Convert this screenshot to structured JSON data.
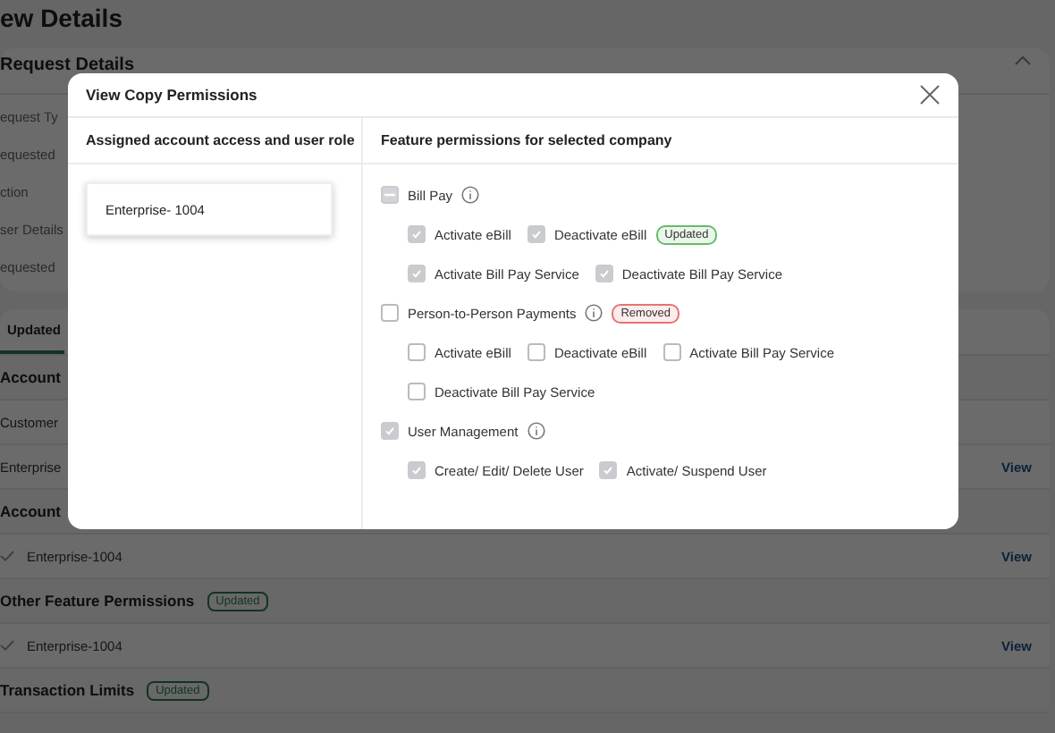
{
  "page": {
    "title": "ew Details",
    "request_card": {
      "title": "Request Details",
      "fields": [
        "equest Ty",
        "equested",
        "ction",
        "ser Details",
        "equested"
      ]
    },
    "changes_card": {
      "tab": {
        "label": "Updated",
        "selected": true
      },
      "lines": [
        {
          "kind": "heading",
          "text": "Account"
        },
        {
          "kind": "label",
          "text": "Customer"
        },
        {
          "kind": "item",
          "text": "Enterprise",
          "link": "View"
        },
        {
          "kind": "heading",
          "text": "Account"
        },
        {
          "kind": "checked-item",
          "text": "Enterprise-1004",
          "link": "View"
        },
        {
          "kind": "heading",
          "text": "Other Feature Permissions",
          "badge": "Updated"
        },
        {
          "kind": "checked-item",
          "text": "Enterprise-1004",
          "link": "View"
        },
        {
          "kind": "heading",
          "text": "Transaction Limits",
          "badge": "Updated"
        }
      ]
    }
  },
  "modal": {
    "title": "View Copy Permissions",
    "left_heading": "Assigned account access and user role",
    "right_heading": "Feature permissions for selected company",
    "accounts": [
      {
        "label": "Enterprise- 1004",
        "selected": true
      }
    ],
    "groups": [
      {
        "label": "Bill Pay",
        "checked": false,
        "indeterminate": true,
        "children": [
          {
            "label": "Activate eBill",
            "checked": true
          },
          {
            "label": "Deactivate eBill",
            "checked": true,
            "badge": {
              "text": "Updated",
              "color": "#66bb6a"
            }
          },
          {
            "label": "Activate Bill Pay Service",
            "checked": true
          },
          {
            "label": "Deactivate Bill Pay Service",
            "checked": true
          }
        ]
      },
      {
        "label": "Person-to-Person Payments",
        "checked": false,
        "indeterminate": false,
        "badge": {
          "text": "Removed",
          "color": "#e57373"
        },
        "children": [
          {
            "label": "Activate eBill",
            "checked": false
          },
          {
            "label": "Deactivate eBill",
            "checked": false
          },
          {
            "label": "Activate Bill Pay Service",
            "checked": false
          },
          {
            "label": "Deactivate Bill Pay Service",
            "checked": false
          }
        ]
      },
      {
        "label": "User Management",
        "checked": true,
        "indeterminate": false,
        "children": [
          {
            "label": "Create/ Edit/ Delete User",
            "checked": true
          },
          {
            "label": "Activate/ Suspend User",
            "checked": true
          }
        ]
      }
    ]
  }
}
